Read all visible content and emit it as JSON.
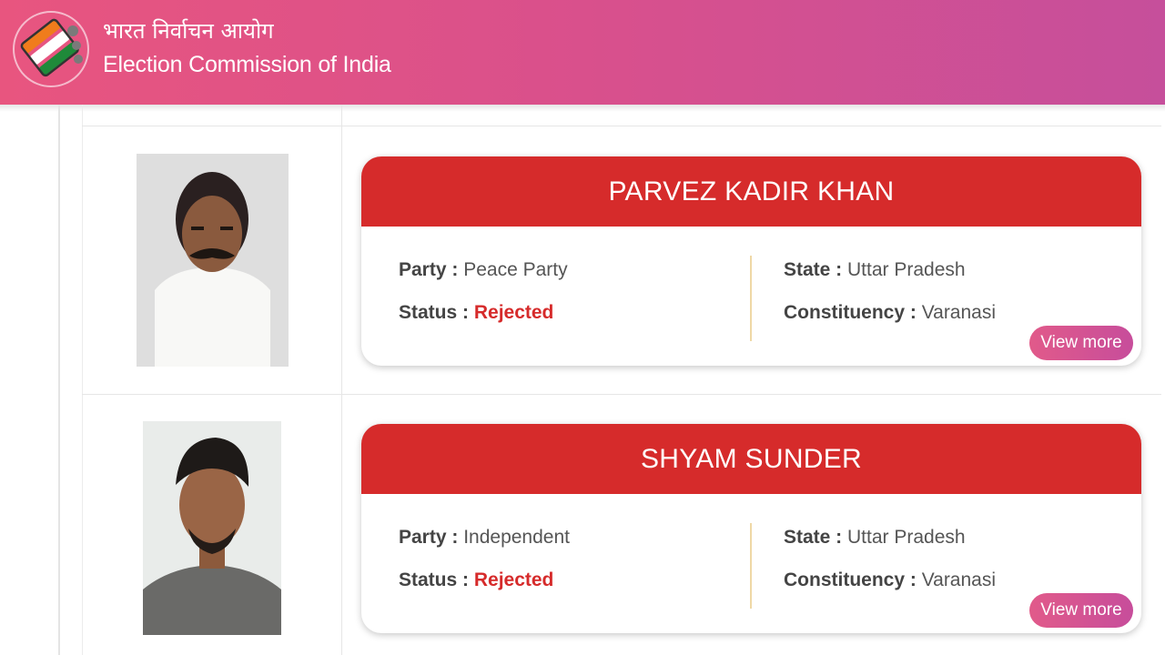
{
  "header": {
    "title_hindi": "भारत निर्वाचन आयोग",
    "title_english": "Election Commission of India",
    "logo_icon": "eci-ballot-logo-icon"
  },
  "candidates": [
    {
      "name": "PARVEZ KADIR KHAN",
      "party_label": "Party :",
      "party": "Peace Party",
      "status_label": "Status :",
      "status": "Rejected",
      "state_label": "State :",
      "state": "Uttar Pradesh",
      "constituency_label": "Constituency :",
      "constituency": "Varanasi",
      "view_more": "View more"
    },
    {
      "name": "SHYAM SUNDER",
      "party_label": "Party :",
      "party": "Independent",
      "status_label": "Status :",
      "status": "Rejected",
      "state_label": "State :",
      "state": "Uttar Pradesh",
      "constituency_label": "Constituency :",
      "constituency": "Varanasi",
      "view_more": "View more"
    }
  ],
  "colors": {
    "header_gradient_start": "#e8557f",
    "header_gradient_end": "#c64f9b",
    "card_header": "#d62b2b",
    "status_rejected": "#d62b2b",
    "button_gradient_start": "#e15a8a",
    "button_gradient_end": "#c74d9b"
  }
}
